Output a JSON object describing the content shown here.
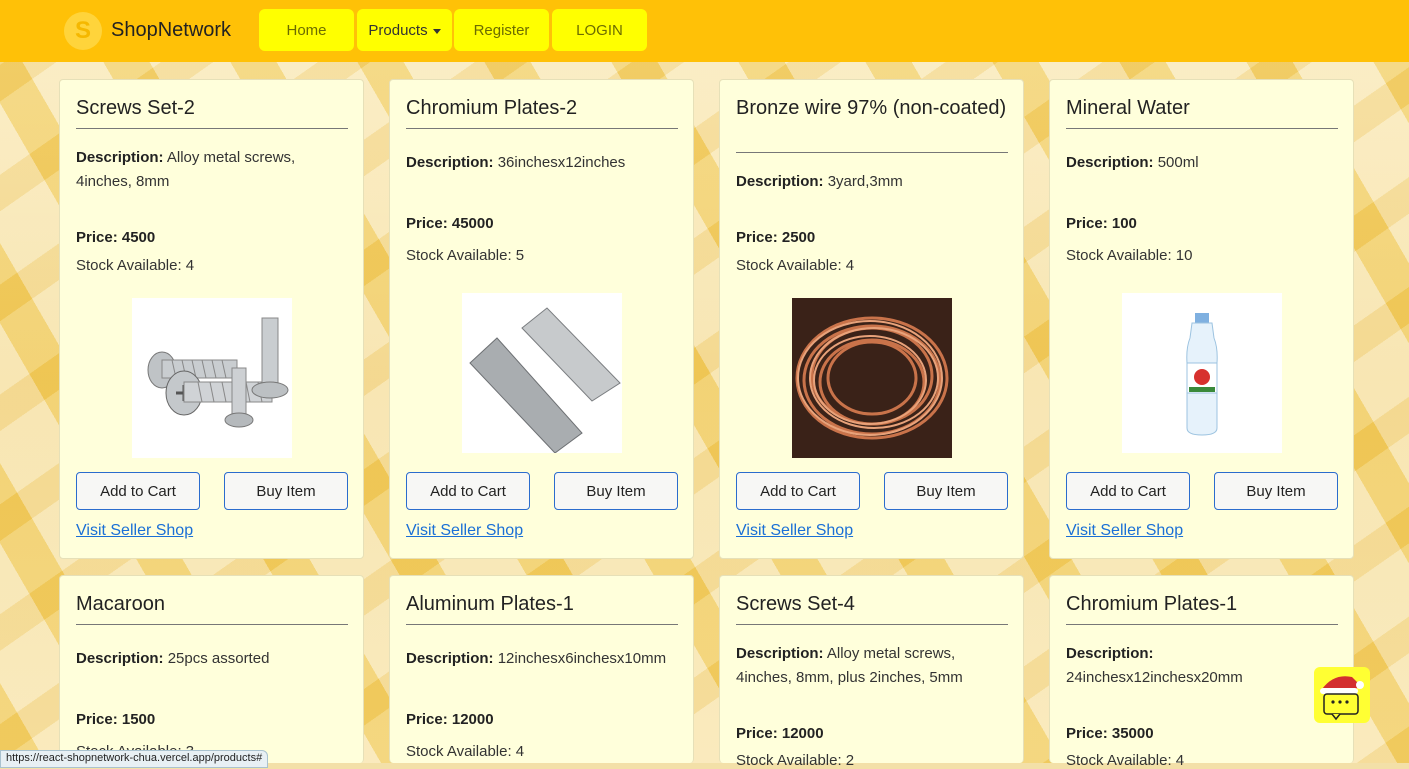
{
  "navbar": {
    "logo_letter": "S",
    "brand": "ShopNetwork",
    "items": [
      {
        "label": "Home"
      },
      {
        "label": "Products"
      },
      {
        "label": "Register"
      },
      {
        "label": "LOGIN"
      }
    ]
  },
  "labels": {
    "description": "Description:",
    "price": "Price:",
    "stock": "Stock Available:",
    "add_to_cart": "Add to Cart",
    "buy_item": "Buy Item",
    "visit_shop": "Visit Seller Shop"
  },
  "products": [
    {
      "title": "Screws Set-2",
      "description": "Alloy metal screws, 4inches, 8mm",
      "price": "4500",
      "stock": "4",
      "image": "screws-image"
    },
    {
      "title": "Chromium Plates-2",
      "description": "36inchesx12inches",
      "price": "45000",
      "stock": "5",
      "image": "metal-plates-image"
    },
    {
      "title": "Bronze wire 97% (non-coated)",
      "description": "3yard,3mm",
      "price": "2500",
      "stock": "4",
      "image": "copper-wire-image"
    },
    {
      "title": "Mineral Water",
      "description": "500ml",
      "price": "100",
      "stock": "10",
      "image": "water-bottle-image"
    },
    {
      "title": "Macaroon",
      "description": "25pcs assorted",
      "price": "1500",
      "stock": "3"
    },
    {
      "title": "Aluminum Plates-1",
      "description": "12inchesx6inchesx10mm",
      "price": "12000",
      "stock": "4"
    },
    {
      "title": "Screws Set-4",
      "description": "Alloy metal screws, 4inches, 8mm, plus 2inches, 5mm",
      "price": "12000",
      "stock": "2"
    },
    {
      "title": "Chromium Plates-1",
      "description": "24inchesx12inchesx20mm",
      "price": "35000",
      "stock": "4"
    }
  ],
  "status_bar": {
    "url": "https://react-shopnetwork-chua.vercel.app/products#"
  },
  "chat_widget": {
    "icon": "chat-bot-santa-icon"
  },
  "colors": {
    "navbar": "#ffc107",
    "nav_button": "#ffff00",
    "card": "#ffffdb",
    "link": "#1a6fd6",
    "button_border": "#2b6ccd"
  }
}
